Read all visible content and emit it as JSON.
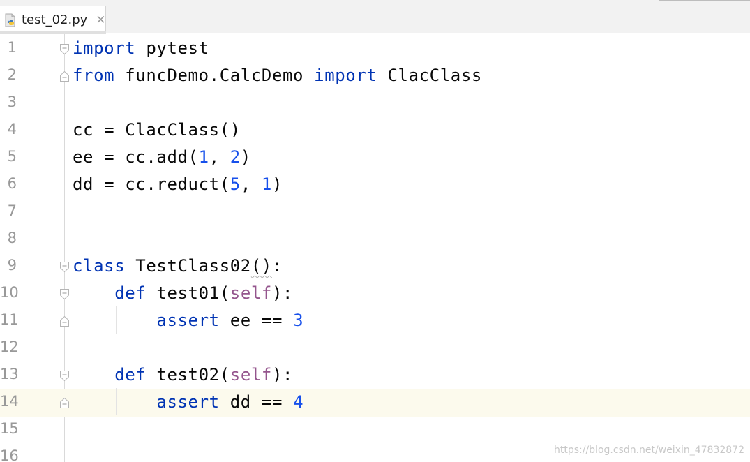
{
  "tab": {
    "file_name": "test_02.py",
    "close_glyph": "✕",
    "icon": "python-file-icon"
  },
  "lines": [
    {
      "no": "1",
      "pre": "",
      "segments": [
        {
          "t": "import",
          "c": "kw"
        },
        {
          "t": " pytest",
          "c": ""
        }
      ]
    },
    {
      "no": "2",
      "pre": "",
      "segments": [
        {
          "t": "from",
          "c": "kw"
        },
        {
          "t": " funcDemo.CalcDemo ",
          "c": ""
        },
        {
          "t": "import",
          "c": "kw"
        },
        {
          "t": " ClacClass",
          "c": ""
        }
      ]
    },
    {
      "no": "3",
      "pre": "",
      "segments": []
    },
    {
      "no": "4",
      "pre": "",
      "segments": [
        {
          "t": "cc = ClacClass()",
          "c": ""
        }
      ]
    },
    {
      "no": "5",
      "pre": "",
      "segments": [
        {
          "t": "ee = cc.add(",
          "c": ""
        },
        {
          "t": "1",
          "c": "num"
        },
        {
          "t": ", ",
          "c": ""
        },
        {
          "t": "2",
          "c": "num"
        },
        {
          "t": ")",
          "c": ""
        }
      ]
    },
    {
      "no": "6",
      "pre": "",
      "segments": [
        {
          "t": "dd = cc.reduct(",
          "c": ""
        },
        {
          "t": "5",
          "c": "num"
        },
        {
          "t": ", ",
          "c": ""
        },
        {
          "t": "1",
          "c": "num"
        },
        {
          "t": ")",
          "c": ""
        }
      ]
    },
    {
      "no": "7",
      "pre": "",
      "segments": []
    },
    {
      "no": "8",
      "pre": "",
      "segments": []
    },
    {
      "no": "9",
      "pre": "",
      "segments": [
        {
          "t": "class",
          "c": "kw"
        },
        {
          "t": " TestClass02",
          "c": ""
        },
        {
          "t": "()",
          "c": "squig"
        },
        {
          "t": ":",
          "c": ""
        }
      ]
    },
    {
      "no": "10",
      "pre": "    ",
      "segments": [
        {
          "t": "def",
          "c": "kw"
        },
        {
          "t": " test01(",
          "c": ""
        },
        {
          "t": "self",
          "c": "self"
        },
        {
          "t": "):",
          "c": ""
        }
      ]
    },
    {
      "no": "11",
      "pre": "        ",
      "segments": [
        {
          "t": "assert",
          "c": "kw"
        },
        {
          "t": " ee == ",
          "c": ""
        },
        {
          "t": "3",
          "c": "num"
        }
      ]
    },
    {
      "no": "12",
      "pre": "",
      "segments": []
    },
    {
      "no": "13",
      "pre": "    ",
      "segments": [
        {
          "t": "def",
          "c": "kw"
        },
        {
          "t": " test02(",
          "c": ""
        },
        {
          "t": "self",
          "c": "self"
        },
        {
          "t": "):",
          "c": ""
        }
      ]
    },
    {
      "no": "14",
      "pre": "        ",
      "segments": [
        {
          "t": "assert",
          "c": "kw"
        },
        {
          "t": " dd == ",
          "c": ""
        },
        {
          "t": "4",
          "c": "num"
        }
      ]
    },
    {
      "no": "15",
      "pre": "",
      "segments": []
    },
    {
      "no": "16",
      "pre": "",
      "segments": []
    }
  ],
  "fold_markers": {
    "1": "open",
    "2": "close",
    "9": "open",
    "10": "open",
    "11": "close",
    "13": "open",
    "14": "close"
  },
  "current_line": "14",
  "colors": {
    "keyword": "#0033b3",
    "number": "#1750eb",
    "self": "#94558d",
    "current_line_bg": "#fcfaed"
  },
  "watermark": "https://blog.csdn.net/weixin_47832872"
}
